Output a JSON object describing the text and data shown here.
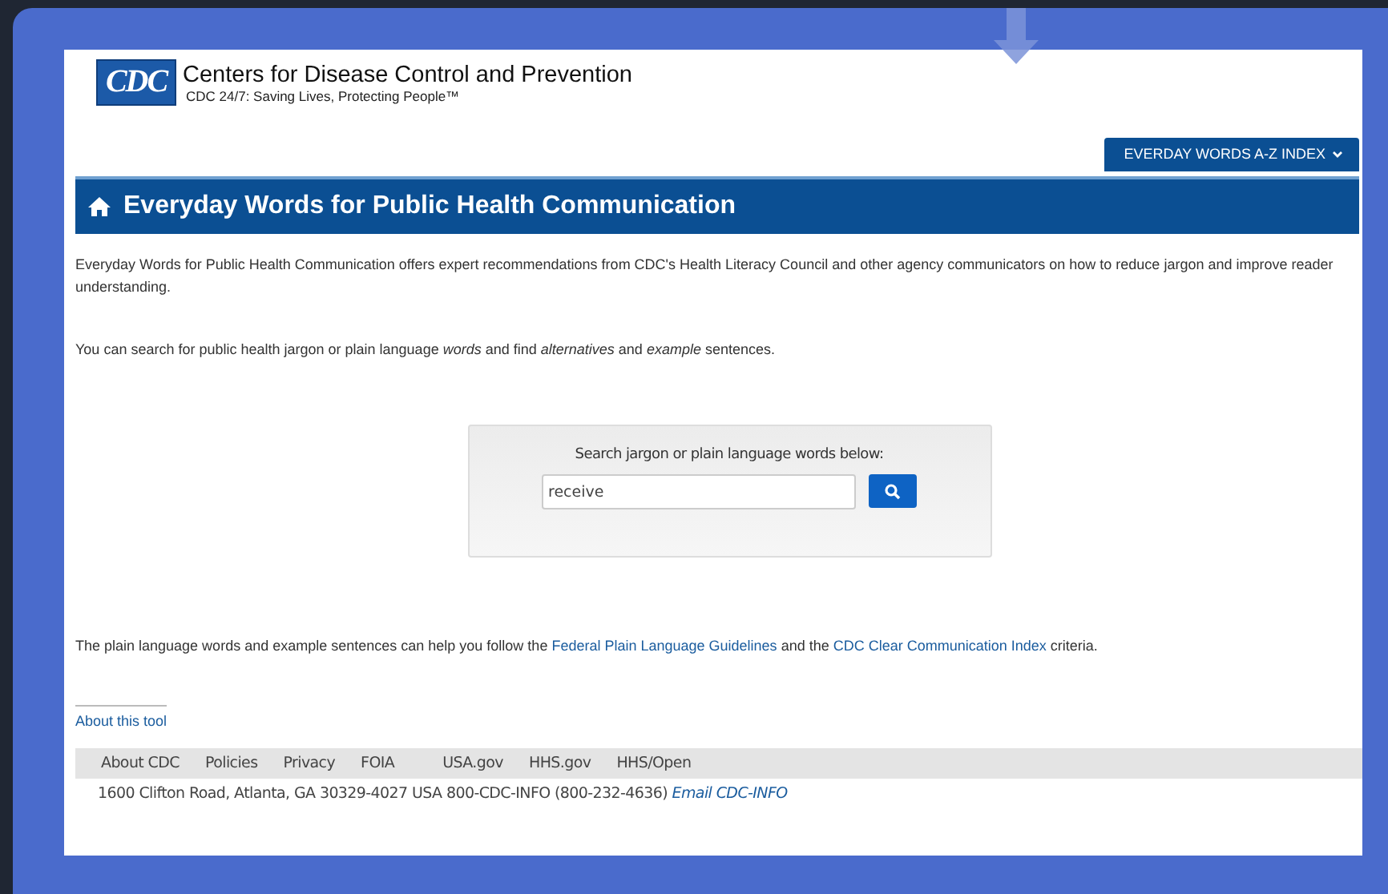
{
  "header": {
    "logo": "CDC",
    "org_name": "Centers for Disease Control and Prevention",
    "tagline": "CDC 24/7: Saving Lives, Protecting People™"
  },
  "index_button": {
    "label": "EVERDAY WORDS A-Z INDEX"
  },
  "title_bar": {
    "title": "Everyday Words for Public Health Communication"
  },
  "intro": "Everyday Words for Public Health Communication offers expert recommendations from CDC's Health Literacy Council and other agency communicators on how to reduce jargon and improve reader understanding.",
  "search_hint": "You can search for public health jargon or plain language *words* and find *alternatives* and *example* sentences.",
  "search": {
    "label": "Search jargon or plain language words below:",
    "value": "receive"
  },
  "guidelines": [
    {
      "kind": "text",
      "text": "The plain language words and example sentences can help you follow the "
    },
    {
      "kind": "link",
      "text": "Federal Plain Language Guidelines"
    },
    {
      "kind": "text",
      "text": " and the "
    },
    {
      "kind": "link",
      "text": "CDC Clear Communication Index"
    },
    {
      "kind": "text",
      "text": " criteria."
    }
  ],
  "about_link": "About this tool",
  "footer": {
    "links": [
      "About CDC",
      "Policies",
      "Privacy",
      "FOIA",
      "USA.gov",
      "HHS.gov",
      "HHS/Open"
    ],
    "address": "1600 Clifton Road, Atlanta, GA 30329-4027 USA 800-CDC-INFO (800-232-4636)",
    "email_link": "Email CDC-INFO"
  }
}
